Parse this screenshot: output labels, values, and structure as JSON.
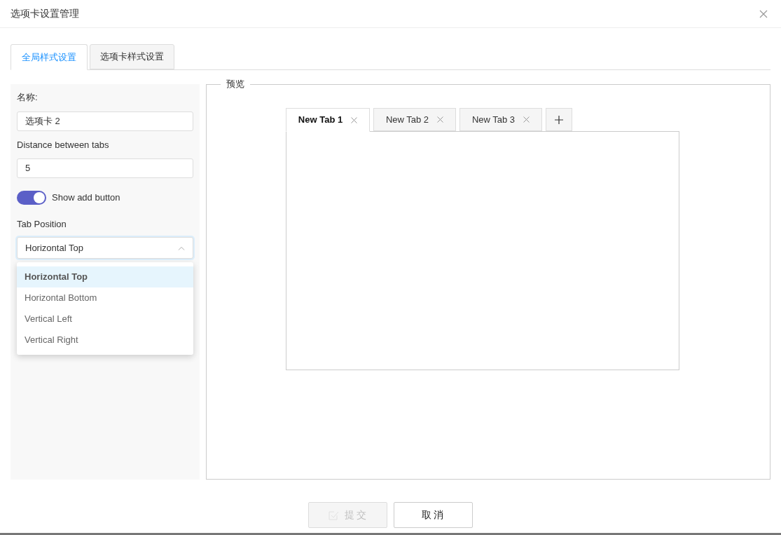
{
  "dialog": {
    "title": "选项卡设置管理"
  },
  "tabs": [
    {
      "label": "全局样式设置",
      "selected": true
    },
    {
      "label": "选项卡样式设置",
      "selected": false
    }
  ],
  "form": {
    "name_label": "名称:",
    "name_value": "选项卡 2",
    "distance_label": "Distance between tabs",
    "distance_value": "5",
    "toggle": {
      "label": "Show add button",
      "on": true
    },
    "position_label": "Tab Position",
    "position_value": "Horizontal Top",
    "dropdown_expanded": true,
    "options": [
      {
        "label": "Horizontal Top",
        "selected": true
      },
      {
        "label": "Horizontal Bottom",
        "selected": false
      },
      {
        "label": "Vertical Left",
        "selected": false
      },
      {
        "label": "Vertical Right",
        "selected": false
      }
    ]
  },
  "preview": {
    "legend": "预览",
    "tabs": [
      {
        "label": "New Tab 1",
        "selected": true
      },
      {
        "label": "New Tab 2",
        "selected": false
      },
      {
        "label": "New Tab 3",
        "selected": false
      }
    ]
  },
  "buttons": [
    {
      "label": "提交",
      "disabled": true,
      "kind": "submit"
    },
    {
      "label": "取消",
      "disabled": false,
      "kind": "cancel"
    }
  ]
}
